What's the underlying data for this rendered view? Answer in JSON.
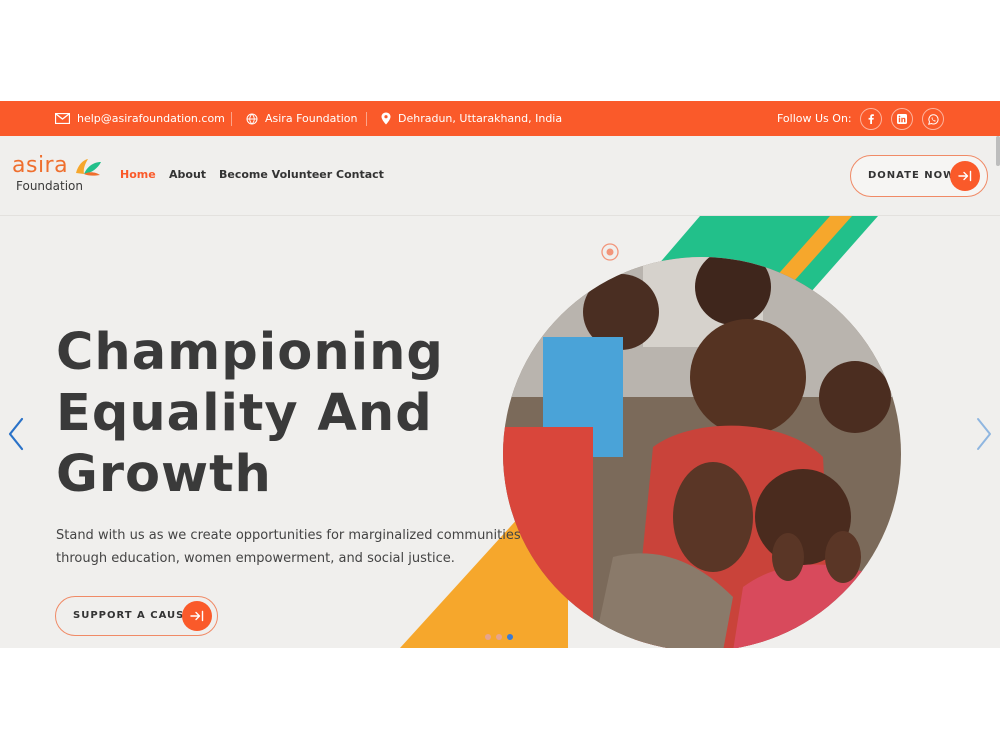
{
  "topbar": {
    "email": "help@asirafoundation.com",
    "org": "Asira Foundation",
    "location": "Dehradun, Uttarakhand, India",
    "follow_label": "Follow Us On:",
    "socials": [
      "facebook-icon",
      "linkedin-icon",
      "whatsapp-icon"
    ]
  },
  "logo": {
    "word": "asira",
    "sub": "Foundation"
  },
  "nav": {
    "items": [
      {
        "label": "Home",
        "active": true
      },
      {
        "label": "About"
      },
      {
        "label": "Become Volunteer"
      },
      {
        "label": "Contact"
      }
    ],
    "donate_label": "DONATE NOW"
  },
  "hero": {
    "title_lines": [
      "Championing",
      "Equality And",
      "Growth"
    ],
    "subtitle_lines": [
      "Stand with us as we create opportunities for marginalized communities",
      "through education, women empowerment, and social justice."
    ],
    "cta_label": "SUPPORT A CAUSE",
    "slides": 3,
    "active_slide": 3
  },
  "colors": {
    "primary": "#fa5a2a",
    "green": "#22c08a",
    "yellow": "#f6a72c",
    "text": "#3a3a3a",
    "hero_bg": "#f0efed",
    "dot_active": "#3a7bd5"
  }
}
